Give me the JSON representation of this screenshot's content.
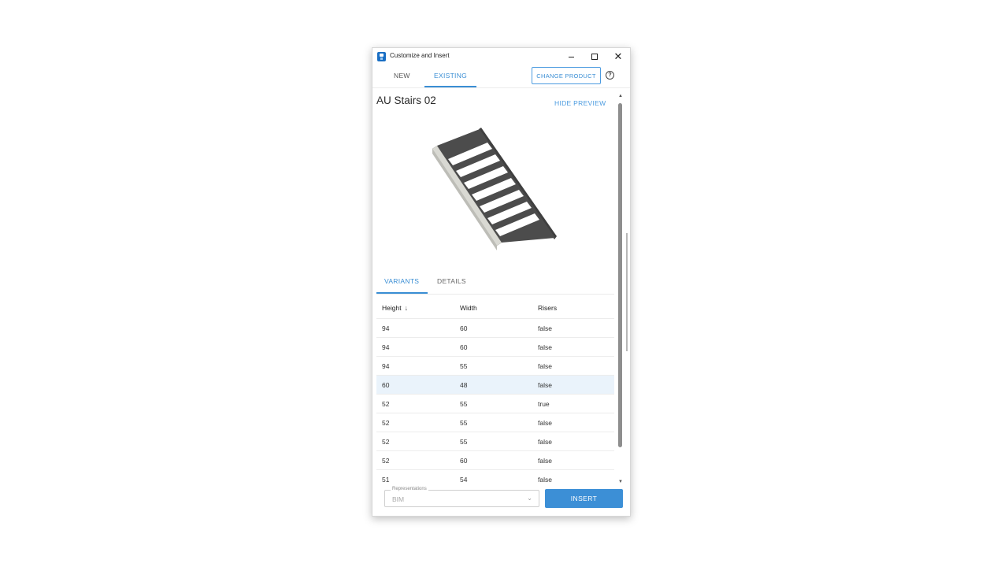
{
  "window": {
    "title": "Customize and Insert",
    "icons": {
      "app": "app-icon",
      "minimize": "minimize-icon",
      "maximize": "maximize-icon",
      "close": "close-icon"
    }
  },
  "nav": {
    "tabs": [
      {
        "label": "NEW",
        "active": false
      },
      {
        "label": "EXISTING",
        "active": true
      }
    ],
    "change_product_label": "CHANGE PRODUCT",
    "help_icon": "help-circle-icon"
  },
  "product": {
    "title": "AU Stairs 02",
    "hide_preview_label": "HIDE PREVIEW"
  },
  "subtabs": [
    {
      "label": "VARIANTS",
      "active": true
    },
    {
      "label": "DETAILS",
      "active": false
    }
  ],
  "table": {
    "columns": [
      "Height",
      "Width",
      "Risers"
    ],
    "sort_icon": "arrow-down-icon",
    "rows": [
      [
        "94",
        "60",
        "false"
      ],
      [
        "94",
        "60",
        "false"
      ],
      [
        "94",
        "55",
        "false"
      ],
      [
        "60",
        "48",
        "false"
      ],
      [
        "52",
        "55",
        "true"
      ],
      [
        "52",
        "55",
        "false"
      ],
      [
        "52",
        "55",
        "false"
      ],
      [
        "52",
        "60",
        "false"
      ],
      [
        "51",
        "54",
        "false"
      ]
    ],
    "selected_row_index": 3
  },
  "footer": {
    "representations_label": "Representations",
    "representations_value": "BIM",
    "insert_label": "INSERT"
  },
  "colors": {
    "accent": "#3a8ed4",
    "selected_row": "#eaf3fb",
    "stair_dark": "#4a4a4a",
    "stair_light": "#cfcfc9"
  }
}
